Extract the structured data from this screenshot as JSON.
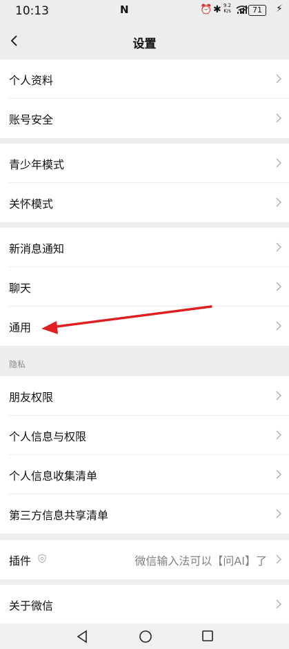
{
  "status_bar": {
    "time": "10:13",
    "net_speed_value": "9.2",
    "net_speed_unit": "K/s",
    "battery": "71"
  },
  "header": {
    "title": "设置"
  },
  "groups": {
    "account": [
      "个人资料",
      "账号安全"
    ],
    "modes": [
      "青少年模式",
      "关怀模式"
    ],
    "general": [
      "新消息通知",
      "聊天",
      "通用"
    ],
    "privacy_header": "隐私",
    "privacy": [
      "朋友权限",
      "个人信息与权限",
      "个人信息收集清单",
      "第三方信息共享清单"
    ],
    "plugins": {
      "label": "插件",
      "value": "微信输入法可以【问AI】了"
    },
    "about": "关于微信"
  },
  "colors": {
    "background": "#ededed",
    "row": "#ffffff",
    "annotation_arrow": "#e02020"
  },
  "icons": [
    "back-arrow-icon",
    "chevron-right-icon",
    "plugin-shield-icon",
    "nav-back-icon",
    "nav-home-icon",
    "nav-recents-icon"
  ]
}
